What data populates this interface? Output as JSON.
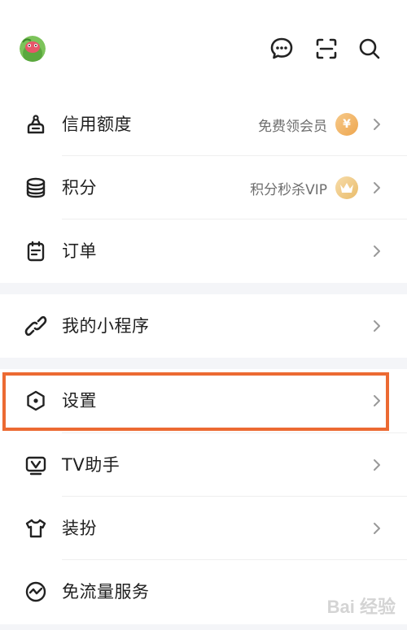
{
  "header": {
    "avatar": "avatar-icon",
    "icons": [
      "chat-bubble-icon",
      "scan-icon",
      "search-icon"
    ]
  },
  "menu": {
    "credit": {
      "label": "信用额度",
      "extra": "免费领会员",
      "badge": "¥",
      "icon": "cake-icon"
    },
    "points": {
      "label": "积分",
      "extra": "积分秒杀VIP",
      "badge": "crown-icon",
      "icon": "coins-stack-icon"
    },
    "orders": {
      "label": "订单",
      "icon": "order-list-icon"
    },
    "mini_programs": {
      "label": "我的小程序",
      "icon": "link-icon"
    },
    "settings": {
      "label": "设置",
      "icon": "hexagon-settings-icon"
    },
    "tv_helper": {
      "label": "TV助手",
      "icon": "tv-icon"
    },
    "dress_up": {
      "label": "装扮",
      "icon": "tshirt-icon"
    },
    "free_data": {
      "label": "免流量服务",
      "icon": "pulse-icon"
    }
  },
  "watermark": "Bai 经验",
  "colors": {
    "highlight": "#ec6a32",
    "badge": "#eea64e",
    "section_gap": "#f4f5f8"
  }
}
